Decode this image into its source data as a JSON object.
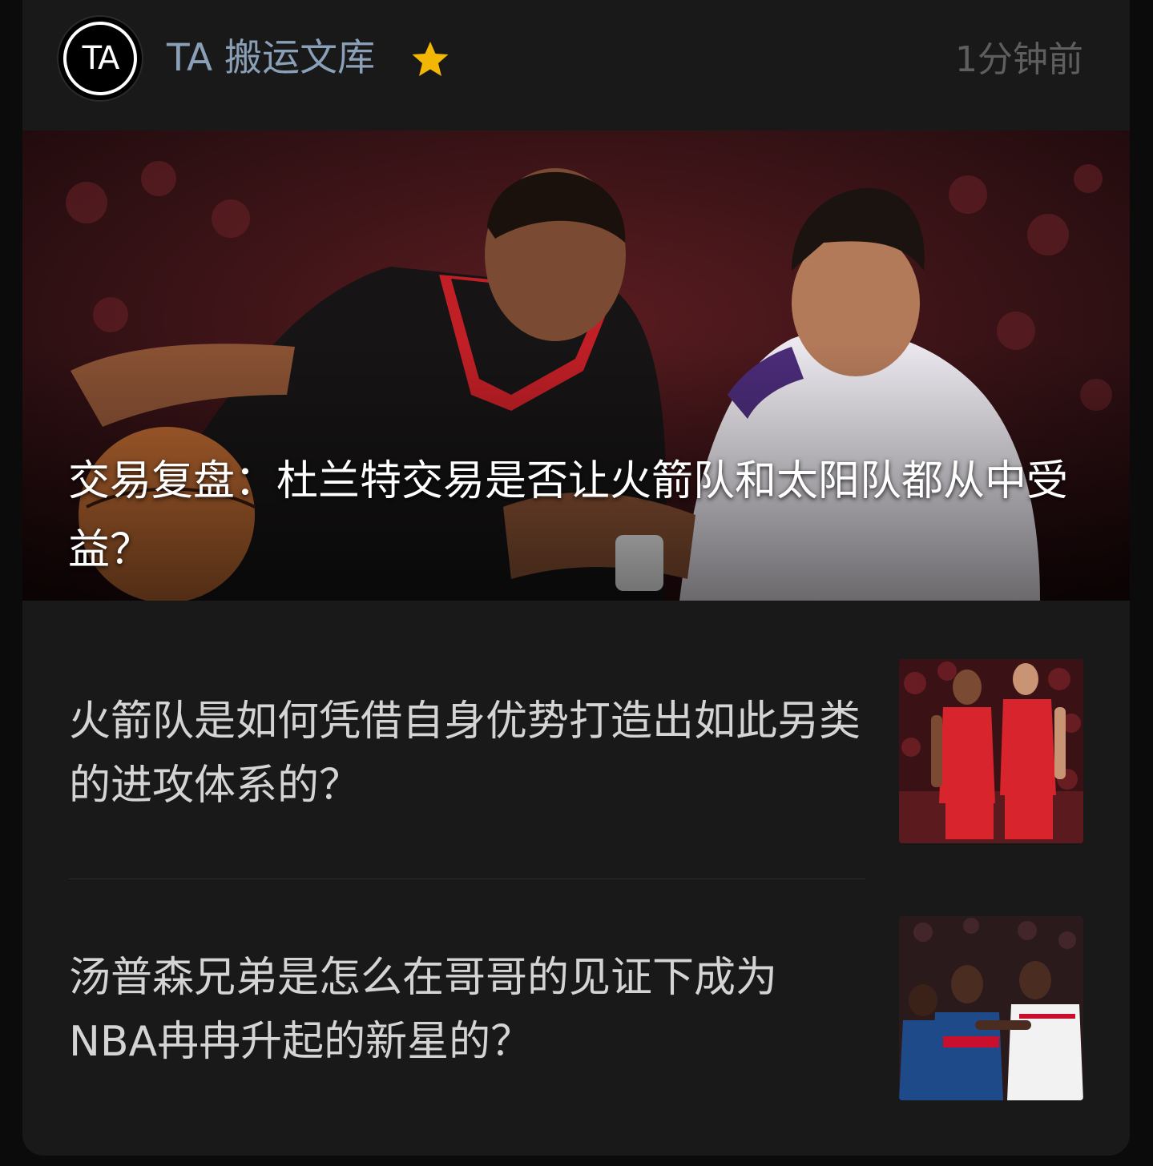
{
  "header": {
    "avatar_text": "TA",
    "author": "TA 搬运文库",
    "badge_icon": "star-icon",
    "time": "1分钟前"
  },
  "hero": {
    "title": "交易复盘：杜兰特交易是否让火箭队和太阳队都从中受益？",
    "image": "basketball-players-photo"
  },
  "articles": [
    {
      "title": "火箭队是如何凭借自身优势打造出如此另类的进攻体系的？",
      "thumbnail": "rockets-players-photo"
    },
    {
      "title": "汤普森兄弟是怎么在哥哥的见证下成为NBA冉冉升起的新星的？",
      "thumbnail": "pistons-rockets-game-photo"
    }
  ],
  "colors": {
    "background": "#191919",
    "author": "#8aa0b8",
    "time": "#5e5e5e",
    "star": "#f2b705",
    "title": "#d4d4d4"
  }
}
